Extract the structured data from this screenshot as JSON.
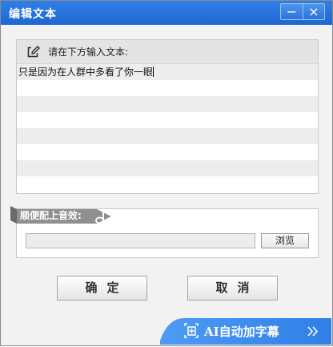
{
  "window": {
    "title": "编辑文本",
    "minimize_glyph": "−",
    "close_glyph": "×"
  },
  "text_panel": {
    "header_icon": "edit-icon",
    "header_label": "请在下方输入文本:",
    "lines": [
      "只是因为在人群中多看了你一眼",
      "",
      "",
      "",
      "",
      "",
      "",
      "",
      ""
    ]
  },
  "music_panel": {
    "label": "顺便配上音效:",
    "note_icon": "music-note-icon",
    "path_value": "",
    "browse_label": "浏览"
  },
  "buttons": {
    "ok_label": "确定",
    "cancel_label": "取消"
  },
  "ai_banner": {
    "label": "AI自动加字幕",
    "icon": "add-subtitle-icon",
    "arrow_icon": "double-chevron-right-icon"
  },
  "colors": {
    "title_blue": "#2470dc",
    "banner_blue": "#3c8ef2",
    "tab_gray": "#8f8f8f"
  }
}
